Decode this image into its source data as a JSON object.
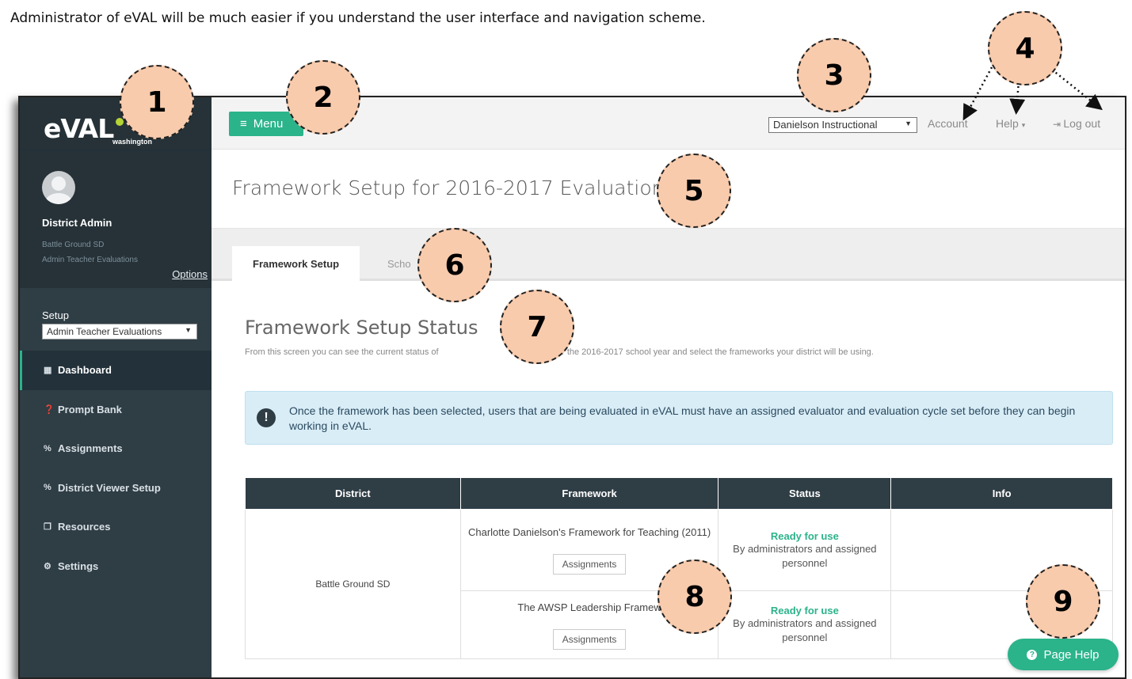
{
  "caption": "Administrator of eVAL will be much easier if you understand the user interface and navigation scheme.",
  "logo": {
    "text": "eVAL",
    "sub": "washington"
  },
  "profile": {
    "name": "District Admin",
    "district": "Battle Ground SD",
    "role": "Admin Teacher Evaluations",
    "options": "Options"
  },
  "setup": {
    "label": "Setup",
    "selected": "Admin Teacher Evaluations"
  },
  "nav": [
    {
      "label": "Dashboard",
      "icon": "grid-icon"
    },
    {
      "label": "Prompt Bank",
      "icon": "question-icon"
    },
    {
      "label": "Assignments",
      "icon": "link-icon"
    },
    {
      "label": "District Viewer Setup",
      "icon": "link-icon"
    },
    {
      "label": "Resources",
      "icon": "copy-icon"
    },
    {
      "label": "Settings",
      "icon": "gears-icon"
    }
  ],
  "topbar": {
    "menu": "Menu",
    "framework_select": "Danielson Instructional",
    "account": "Account",
    "help": "Help",
    "logout": "Log out"
  },
  "page_title": "Framework Setup for 2016-2017 Evaluations",
  "tabs": [
    "Framework Setup",
    "Scho"
  ],
  "section": {
    "title_a": "Framework",
    "title_b": " Setup Status",
    "desc_a": "From this screen you can see the current status of",
    "desc_b": "work setup for the 2016-2017 school year and select the frameworks your district will be using."
  },
  "alert": "Once the framework has been selected, users that are being evaluated in eVAL must have an assigned evaluator and evaluation cycle set before they can begin working in eVAL.",
  "table": {
    "headers": [
      "District",
      "Framework",
      "Status",
      "Info"
    ],
    "district": "Battle Ground SD",
    "rows": [
      {
        "framework": "Charlotte Danielson's Framework for Teaching (2011)",
        "button": "Assignments",
        "status": "Ready for use",
        "status_sub": "By administrators and assigned personnel"
      },
      {
        "framework": "The AWSP Leadership Framew",
        "button": "Assignments",
        "status": "Ready for use",
        "status_sub": "By administrators and assigned personnel"
      }
    ]
  },
  "page_help": "Page Help",
  "callouts": [
    "1",
    "2",
    "3",
    "4",
    "5",
    "6",
    "7",
    "8",
    "9"
  ],
  "colors": {
    "accent": "#2bb38a",
    "sidebar": "#2f3d45",
    "callout_fill": "#f8cbad",
    "alert_bg": "#d9edf7"
  }
}
